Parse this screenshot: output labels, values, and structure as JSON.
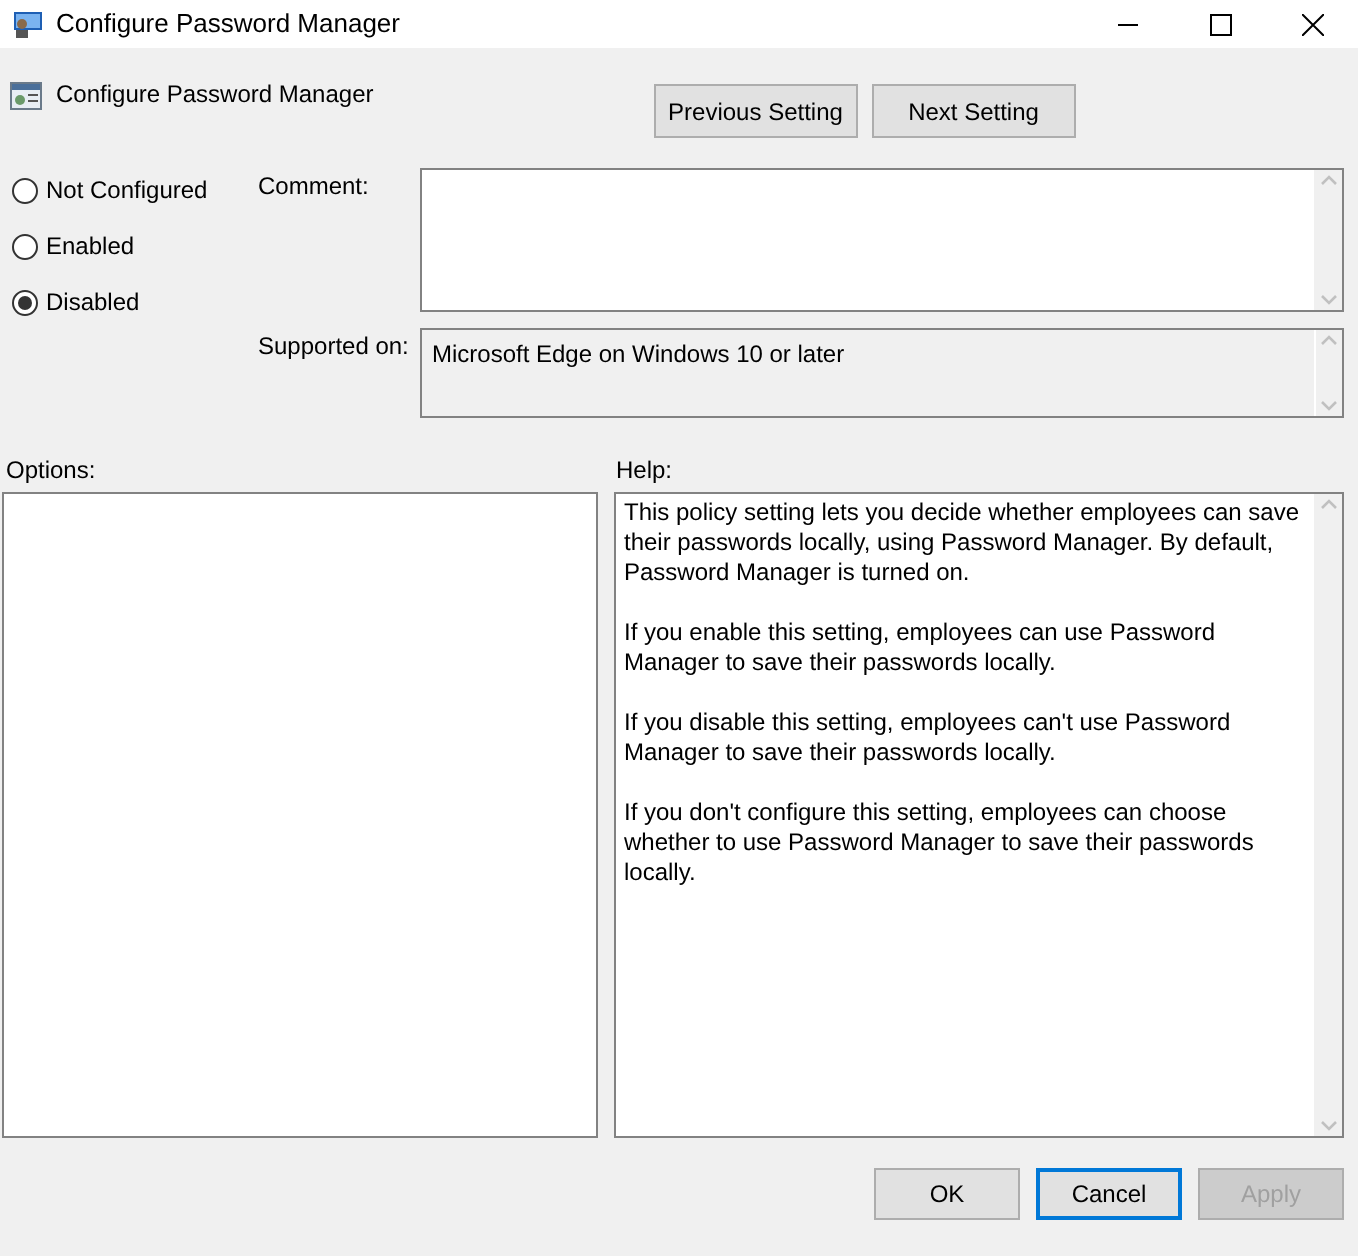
{
  "window": {
    "title": "Configure Password Manager"
  },
  "header": {
    "title": "Configure Password Manager",
    "buttons": [
      {
        "label": "Previous Setting"
      },
      {
        "label": "Next Setting"
      }
    ]
  },
  "state_options": [
    {
      "label": "Not Configured",
      "selected": false
    },
    {
      "label": "Enabled",
      "selected": false
    },
    {
      "label": "Disabled",
      "selected": true
    }
  ],
  "comment": {
    "label": "Comment:"
  },
  "supported_on": {
    "label": "Supported on:",
    "value": "Microsoft Edge on Windows 10 or later"
  },
  "options": {
    "label": "Options:"
  },
  "help": {
    "label": "Help:",
    "paragraphs": [
      "This policy setting lets you decide whether employees can save their passwords locally, using Password Manager. By default, Password Manager is turned on.",
      "If you enable this setting, employees can use Password Manager to save their passwords locally.",
      "If you disable this setting, employees can't use Password Manager to save their passwords locally.",
      "If you don't configure this setting, employees can choose whether to use Password Manager to save their passwords locally."
    ]
  },
  "footer_buttons": [
    {
      "label": "OK",
      "focused": false,
      "disabled": false
    },
    {
      "label": "Cancel",
      "focused": true,
      "disabled": false
    },
    {
      "label": "Apply",
      "focused": false,
      "disabled": true
    }
  ]
}
